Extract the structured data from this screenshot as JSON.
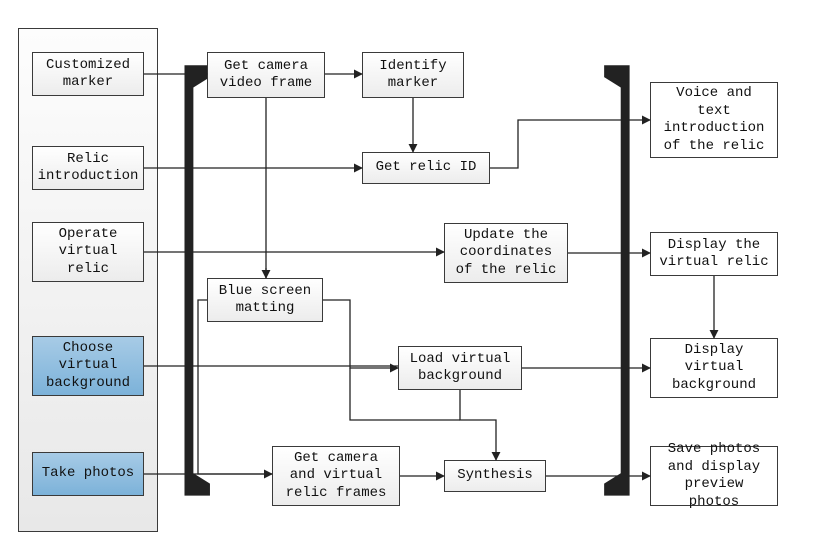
{
  "diagram": {
    "inputs": {
      "customized_marker": "Customized\nmarker",
      "relic_introduction": "Relic\nintroduction",
      "operate_virtual_relic": "Operate\nvirtual\nrelic",
      "choose_virtual_background": "Choose\nvirtual\nbackground",
      "take_photos": "Take photos"
    },
    "process": {
      "get_camera_video_frame": "Get camera\nvideo frame",
      "identify_marker": "Identify\nmarker",
      "get_relic_id": "Get relic ID",
      "update_coordinates": "Update the\ncoordinates\nof the relic",
      "blue_screen_matting": "Blue screen\nmatting",
      "load_virtual_background": "Load virtual\nbackground",
      "get_camera_relic_frames": "Get camera\nand virtual\nrelic frames",
      "synthesis": "Synthesis"
    },
    "outputs": {
      "voice_text_intro": "Voice and\ntext\nintroduction\nof the relic",
      "display_virtual_relic": "Display the\nvirtual relic",
      "display_virtual_background": "Display\nvirtual\nbackground",
      "save_display_preview": "Save photos\nand display\npreview photos"
    }
  },
  "chart_data": {
    "type": "diagram",
    "title": "",
    "columns": [
      {
        "name": "inputs",
        "role": "user actions / triggers"
      },
      {
        "name": "process",
        "role": "processing pipeline (inside brackets)"
      },
      {
        "name": "outputs",
        "role": "results / displays"
      }
    ],
    "nodes": [
      {
        "id": "customized_marker",
        "col": "inputs",
        "label": "Customized marker",
        "highlight": false
      },
      {
        "id": "relic_introduction",
        "col": "inputs",
        "label": "Relic introduction",
        "highlight": false
      },
      {
        "id": "operate_virtual_relic",
        "col": "inputs",
        "label": "Operate virtual relic",
        "highlight": false
      },
      {
        "id": "choose_virtual_background",
        "col": "inputs",
        "label": "Choose virtual background",
        "highlight": true
      },
      {
        "id": "take_photos",
        "col": "inputs",
        "label": "Take photos",
        "highlight": true
      },
      {
        "id": "get_camera_video_frame",
        "col": "process",
        "label": "Get camera video frame",
        "highlight": false
      },
      {
        "id": "identify_marker",
        "col": "process",
        "label": "Identify marker",
        "highlight": false
      },
      {
        "id": "get_relic_id",
        "col": "process",
        "label": "Get relic ID",
        "highlight": false
      },
      {
        "id": "update_coordinates",
        "col": "process",
        "label": "Update the coordinates of the relic",
        "highlight": false
      },
      {
        "id": "blue_screen_matting",
        "col": "process",
        "label": "Blue screen matting",
        "highlight": false
      },
      {
        "id": "load_virtual_background",
        "col": "process",
        "label": "Load virtual background",
        "highlight": false
      },
      {
        "id": "get_camera_relic_frames",
        "col": "process",
        "label": "Get camera and virtual relic frames",
        "highlight": false
      },
      {
        "id": "synthesis",
        "col": "process",
        "label": "Synthesis",
        "highlight": false
      },
      {
        "id": "voice_text_intro",
        "col": "outputs",
        "label": "Voice and text introduction of the relic",
        "highlight": false
      },
      {
        "id": "display_virtual_relic",
        "col": "outputs",
        "label": "Display the virtual relic",
        "highlight": false
      },
      {
        "id": "display_virtual_background",
        "col": "outputs",
        "label": "Display virtual background",
        "highlight": false
      },
      {
        "id": "save_display_preview",
        "col": "outputs",
        "label": "Save photos and display preview photos",
        "highlight": false
      }
    ],
    "edges": [
      {
        "from": "customized_marker",
        "to": "get_camera_video_frame"
      },
      {
        "from": "get_camera_video_frame",
        "to": "identify_marker"
      },
      {
        "from": "identify_marker",
        "to": "get_relic_id"
      },
      {
        "from": "relic_introduction",
        "to": "get_relic_id"
      },
      {
        "from": "get_relic_id",
        "to": "voice_text_intro"
      },
      {
        "from": "get_camera_video_frame",
        "to": "update_coordinates"
      },
      {
        "from": "operate_virtual_relic",
        "to": "update_coordinates"
      },
      {
        "from": "update_coordinates",
        "to": "display_virtual_relic"
      },
      {
        "from": "get_camera_video_frame",
        "to": "blue_screen_matting"
      },
      {
        "from": "blue_screen_matting",
        "to": "load_virtual_background"
      },
      {
        "from": "choose_virtual_background",
        "to": "load_virtual_background"
      },
      {
        "from": "load_virtual_background",
        "to": "display_virtual_background"
      },
      {
        "from": "display_virtual_relic",
        "to": "display_virtual_background"
      },
      {
        "from": "take_photos",
        "to": "get_camera_relic_frames"
      },
      {
        "from": "blue_screen_matting",
        "to": "get_camera_relic_frames"
      },
      {
        "from": "get_camera_relic_frames",
        "to": "synthesis"
      },
      {
        "from": "load_virtual_background",
        "to": "synthesis"
      },
      {
        "from": "synthesis",
        "to": "save_display_preview"
      }
    ]
  }
}
